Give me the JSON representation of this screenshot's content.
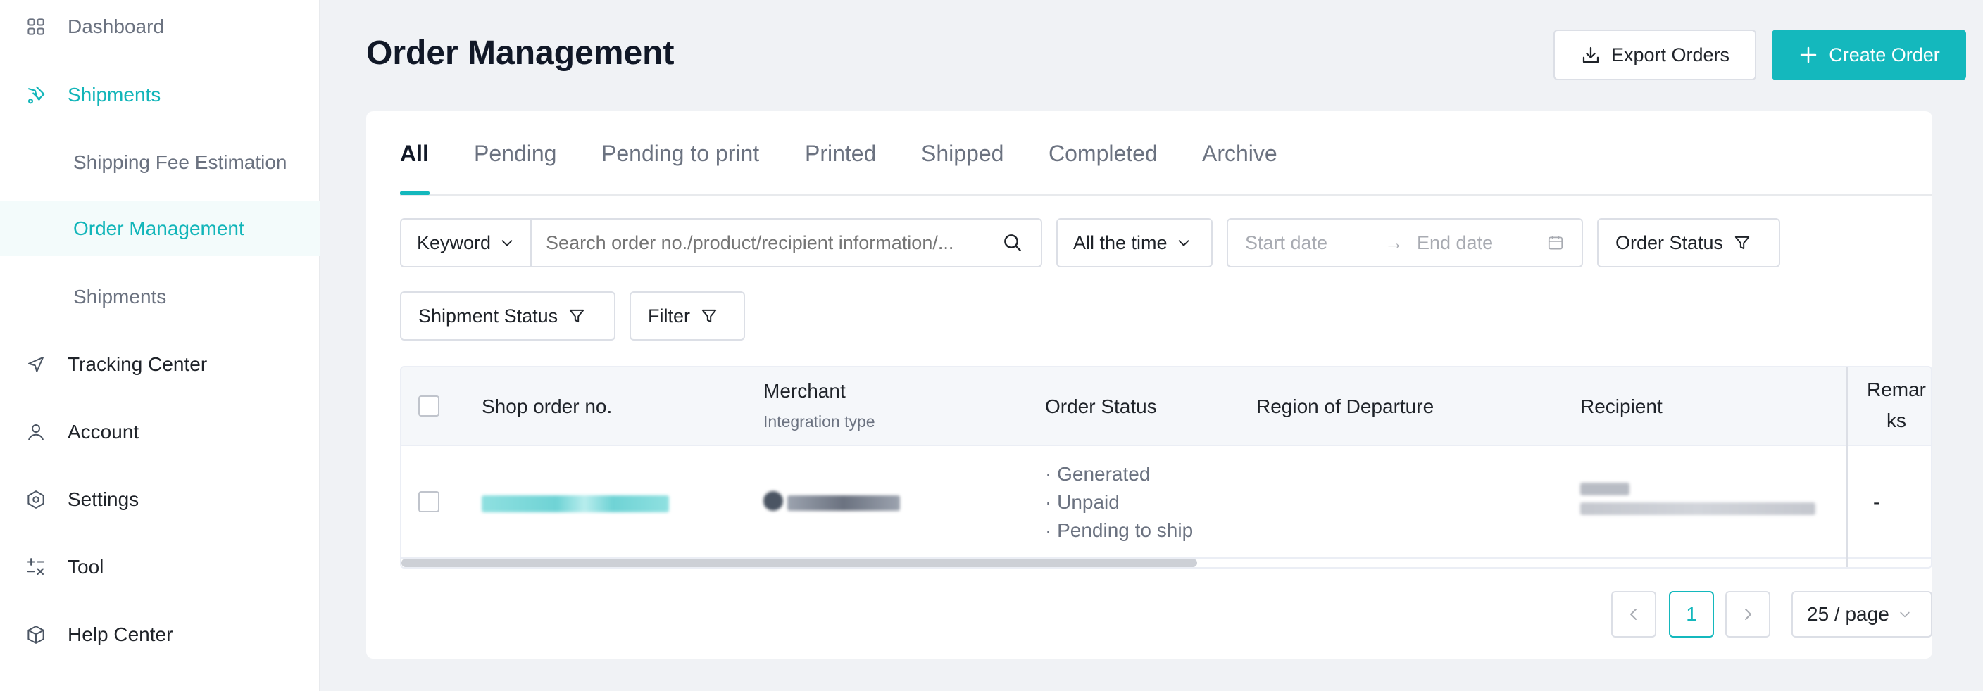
{
  "sidebar": {
    "items": [
      {
        "label": "Dashboard",
        "icon": "dashboard-icon"
      },
      {
        "label": "Shipments",
        "icon": "shipments-icon"
      },
      {
        "label": "Shipping Fee Estimation"
      },
      {
        "label": "Order Management"
      },
      {
        "label": "Shipments"
      },
      {
        "label": "Tracking Center",
        "icon": "send-icon"
      },
      {
        "label": "Account",
        "icon": "user-icon"
      },
      {
        "label": "Settings",
        "icon": "settings-icon"
      },
      {
        "label": "Tool",
        "icon": "calculator-icon"
      },
      {
        "label": "Help Center",
        "icon": "box-icon"
      }
    ]
  },
  "header": {
    "title": "Order Management",
    "export_label": "Export Orders",
    "create_label": "Create Order"
  },
  "tabs": [
    "All",
    "Pending",
    "Pending to print",
    "Printed",
    "Shipped",
    "Completed",
    "Archive"
  ],
  "filters": {
    "keyword_label": "Keyword",
    "search_placeholder": "Search order no./product/recipient information/...",
    "time_label": "All the time",
    "start_placeholder": "Start date",
    "end_placeholder": "End date",
    "order_status_label": "Order Status",
    "shipment_status_label": "Shipment Status",
    "filter_label": "Filter"
  },
  "table": {
    "headers": {
      "shop_order": "Shop order no.",
      "merchant": "Merchant",
      "integration_type": "Integration type",
      "order_status": "Order Status",
      "region": "Region of Departure",
      "recipient": "Recipient",
      "remarks_line1": "Remar",
      "remarks_line2": "ks"
    },
    "rows": [
      {
        "statuses": [
          "· Generated",
          "· Unpaid",
          "· Pending to ship"
        ],
        "remarks": "-"
      }
    ]
  },
  "pagination": {
    "current": "1",
    "page_size": "25 / page"
  },
  "colors": {
    "accent": "#14b8bd",
    "background": "#f0f2f5"
  }
}
